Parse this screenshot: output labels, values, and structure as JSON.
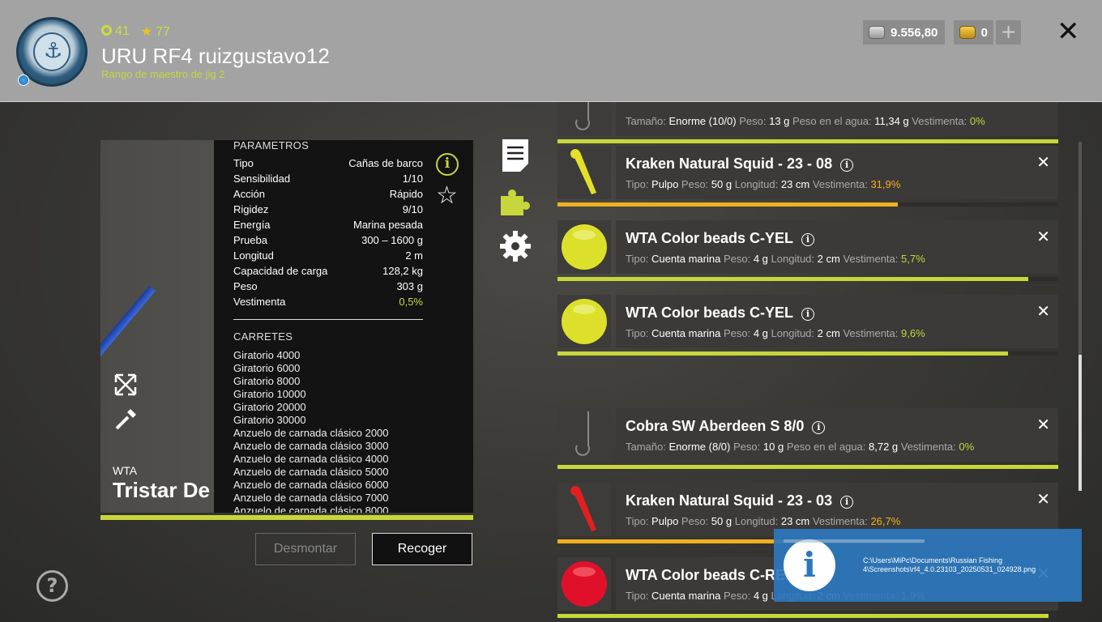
{
  "header": {
    "level": "41",
    "stars": "77",
    "username": "URU RF4 ruizgustavo12",
    "rank": "Rango de maestro de jig 2",
    "silver": "9.556,80",
    "gold": "0",
    "plus": "+",
    "close": "✕"
  },
  "rod": {
    "brand": "WTA",
    "name": "Tristar De",
    "params_title": "PARAMETROS",
    "params": [
      {
        "label": "Tipo",
        "value": "Cañas de barco"
      },
      {
        "label": "Sensibilidad",
        "value": "1/10"
      },
      {
        "label": "Acción",
        "value": "Rápido"
      },
      {
        "label": "Rigidez",
        "value": "9/10"
      },
      {
        "label": "Energía",
        "value": "Marina pesada"
      },
      {
        "label": "Prueba",
        "value": "300 – 1600 g"
      },
      {
        "label": "Longitud",
        "value": "2 m"
      },
      {
        "label": "Capacidad de carga",
        "value": "128,2 kg"
      },
      {
        "label": "Peso",
        "value": "303 g"
      },
      {
        "label": "Vestimenta",
        "value": "0,5%"
      }
    ],
    "reels_title": "CARRETES",
    "reels": [
      "Giratorio 4000",
      "Giratorio 6000",
      "Giratorio 8000",
      "Giratorio 10000",
      "Giratorio 20000",
      "Giratorio 30000",
      "Anzuelo de carnada clásico 2000",
      "Anzuelo de carnada clásico 3000",
      "Anzuelo de carnada clásico 4000",
      "Anzuelo de carnada clásico 5000",
      "Anzuelo de carnada clásico 6000",
      "Anzuelo de carnada clásico 7000",
      "Anzuelo de carnada clásico 8000"
    ],
    "info_icon": "i",
    "wear_fraction": 1.0
  },
  "buttons": {
    "desmontar": "Desmontar",
    "recoger": "Recoger",
    "help": "?"
  },
  "items": [
    {
      "title": "",
      "labels": [
        "Tamaño:",
        "Peso:",
        "Peso en el agua:",
        "Vestimenta:"
      ],
      "values": [
        "Enorme (10/0)",
        "13 g",
        "11,34 g",
        "0%"
      ],
      "wear": 1.0,
      "bar_color": "#c7d63b",
      "thumb": "hook",
      "partial": true
    },
    {
      "title": "Kraken Natural Squid - 23 - 08",
      "labels": [
        "Tipo:",
        "Peso:",
        "Longitud:",
        "Vestimenta:"
      ],
      "values": [
        "Pulpo",
        "50 g",
        "23 cm",
        "31,9%"
      ],
      "wear": 0.68,
      "bar_color": "#f0b020",
      "thumb": "squid-yellow"
    },
    {
      "title": "WTA Color beads C-YEL",
      "labels": [
        "Tipo:",
        "Peso:",
        "Longitud:",
        "Vestimenta:"
      ],
      "values": [
        "Cuenta marina",
        "4 g",
        "2 cm",
        "5,7%"
      ],
      "wear": 0.94,
      "bar_color": "#c7d63b",
      "thumb": "bead-yellow"
    },
    {
      "title": "WTA Color beads C-YEL",
      "labels": [
        "Tipo:",
        "Peso:",
        "Longitud:",
        "Vestimenta:"
      ],
      "values": [
        "Cuenta marina",
        "4 g",
        "2 cm",
        "9,6%"
      ],
      "wear": 0.9,
      "bar_color": "#c7d63b",
      "thumb": "bead-yellow"
    },
    {
      "title": "Cobra SW Aberdeen S 8/0",
      "labels": [
        "Tamaño:",
        "Peso:",
        "Peso en el agua:",
        "Vestimenta:"
      ],
      "values": [
        "Enorme (8/0)",
        "10 g",
        "8,72 g",
        "0%"
      ],
      "wear": 1.0,
      "bar_color": "#c7d63b",
      "thumb": "hook"
    },
    {
      "title": "Kraken Natural Squid - 23 - 03",
      "labels": [
        "Tipo:",
        "Peso:",
        "Longitud:",
        "Vestimenta:"
      ],
      "values": [
        "Pulpo",
        "50 g",
        "23 cm",
        "26,7%"
      ],
      "wear": 0.73,
      "bar_color": "#f0b020",
      "thumb": "squid-red"
    },
    {
      "title": "WTA Color beads C-RED",
      "labels": [
        "Tipo:",
        "Peso:",
        "Longitud:",
        "Vestimenta:"
      ],
      "values": [
        "Cuenta marina",
        "4 g",
        "2 cm",
        "1,9%"
      ],
      "wear": 0.98,
      "bar_color": "#c7d63b",
      "thumb": "bead-red"
    }
  ],
  "toast": {
    "icon": "i",
    "path": "C:\\Users\\MiPc\\Documents\\Russian Fishing 4\\Screenshots\\rf4_4.0.23103_20250531_024928.png"
  },
  "colors": {
    "accent": "#c7d63b",
    "warn": "#f0b020"
  }
}
